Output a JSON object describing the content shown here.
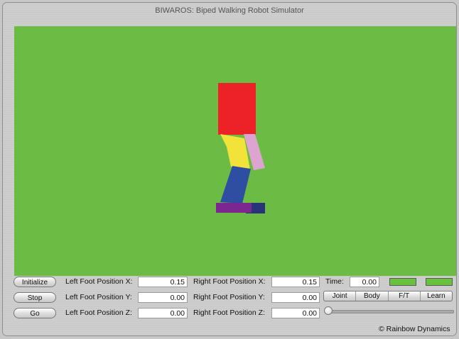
{
  "window": {
    "title": "BIWAROS: Biped Walking Robot Simulator"
  },
  "scene": {
    "background_color": "#6bbb45",
    "robot_colors": {
      "torso": "#ec2226",
      "left_thigh": "#f1e33a",
      "right_thigh": "#dca4cf",
      "shin": "#2e4ea2",
      "left_foot": "#7b278f",
      "right_foot": "#28337b"
    }
  },
  "buttons": {
    "initialize": "Initialize",
    "stop": "Stop",
    "go": "Go"
  },
  "left_foot": {
    "x_label": "Left Foot Position X:",
    "x_value": "0.15",
    "y_label": "Left Foot Position Y:",
    "y_value": "0.00",
    "z_label": "Left Foot Position Z:",
    "z_value": "0.00"
  },
  "right_foot": {
    "x_label": "Right Foot Position X:",
    "x_value": "0.15",
    "y_label": "Right Foot Position Y:",
    "y_value": "0.00",
    "z_label": "Right Foot Position Z:",
    "z_value": "0.00"
  },
  "time": {
    "label": "Time:",
    "value": "0.00"
  },
  "indicators": {
    "color": "#68c23d"
  },
  "view_tabs": [
    "Joint",
    "Body",
    "F/T",
    "Learn"
  ],
  "slider": {
    "value": 0
  },
  "footer": {
    "credit": "© Rainbow Dynamics"
  }
}
